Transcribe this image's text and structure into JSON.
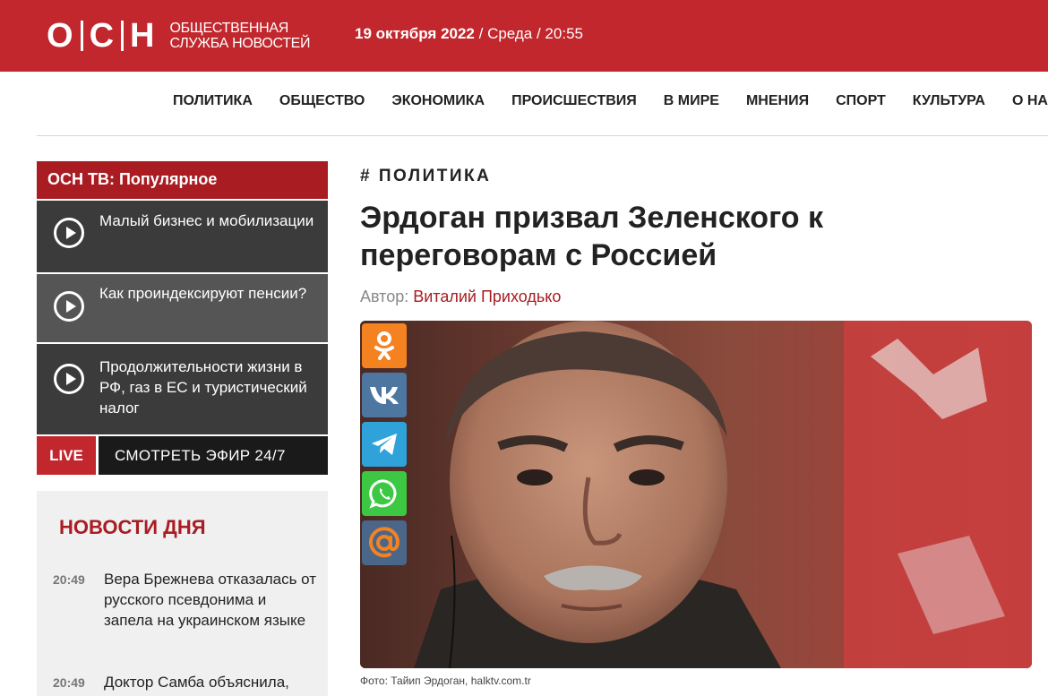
{
  "header": {
    "logo_letters": [
      "О",
      "С",
      "Н"
    ],
    "logo_line1": "Общественная",
    "logo_line2": "служба новостей",
    "date": "19 октября 2022",
    "rest": " / Среда / 20:55"
  },
  "nav": {
    "items": [
      "ПОЛИТИКА",
      "ОБЩЕСТВО",
      "ЭКОНОМИКА",
      "ПРОИСШЕСТВИЯ",
      "В МИРЕ",
      "МНЕНИЯ",
      "СПОРТ",
      "КУЛЬТУРА",
      "О НАС"
    ]
  },
  "tv": {
    "title": "ОСН ТВ: Популярное",
    "items": [
      {
        "title": "Малый бизнес и мобилизации"
      },
      {
        "title": "Как проиндексируют пенсии?"
      },
      {
        "title": "Продолжительности жизни в РФ, газ в ЕС и туристический налог"
      }
    ],
    "live": "LIVE",
    "watch": "СМОТРЕТЬ ЭФИР 24/7"
  },
  "news": {
    "title": "НОВОСТИ ДНЯ",
    "items": [
      {
        "time": "20:49",
        "text": "Вера Брежнева отказалась от русского псевдонима и запела на украинском языке"
      },
      {
        "time": "20:49",
        "text": "Доктор Самба объяснила,"
      }
    ]
  },
  "article": {
    "category": "# ПОЛИТИКА",
    "headline": "Эрдоган призвал Зеленского к переговорам с Россией",
    "author_label": "Автор: ",
    "author_name": "Виталий Приходько",
    "caption": "Фото: Тайип Эрдоган, halktv.com.tr"
  },
  "share": {
    "buttons": [
      {
        "name": "odnoklassniki-icon",
        "color": "#f58220"
      },
      {
        "name": "vk-icon",
        "color": "#4d76a1"
      },
      {
        "name": "telegram-icon",
        "color": "#2fa3d9"
      },
      {
        "name": "whatsapp-icon",
        "color": "#3dc843"
      },
      {
        "name": "mailru-icon",
        "color": "#4a6688"
      }
    ]
  },
  "colors": {
    "brand_red": "#c1272d",
    "dark_red": "#a81c22"
  }
}
